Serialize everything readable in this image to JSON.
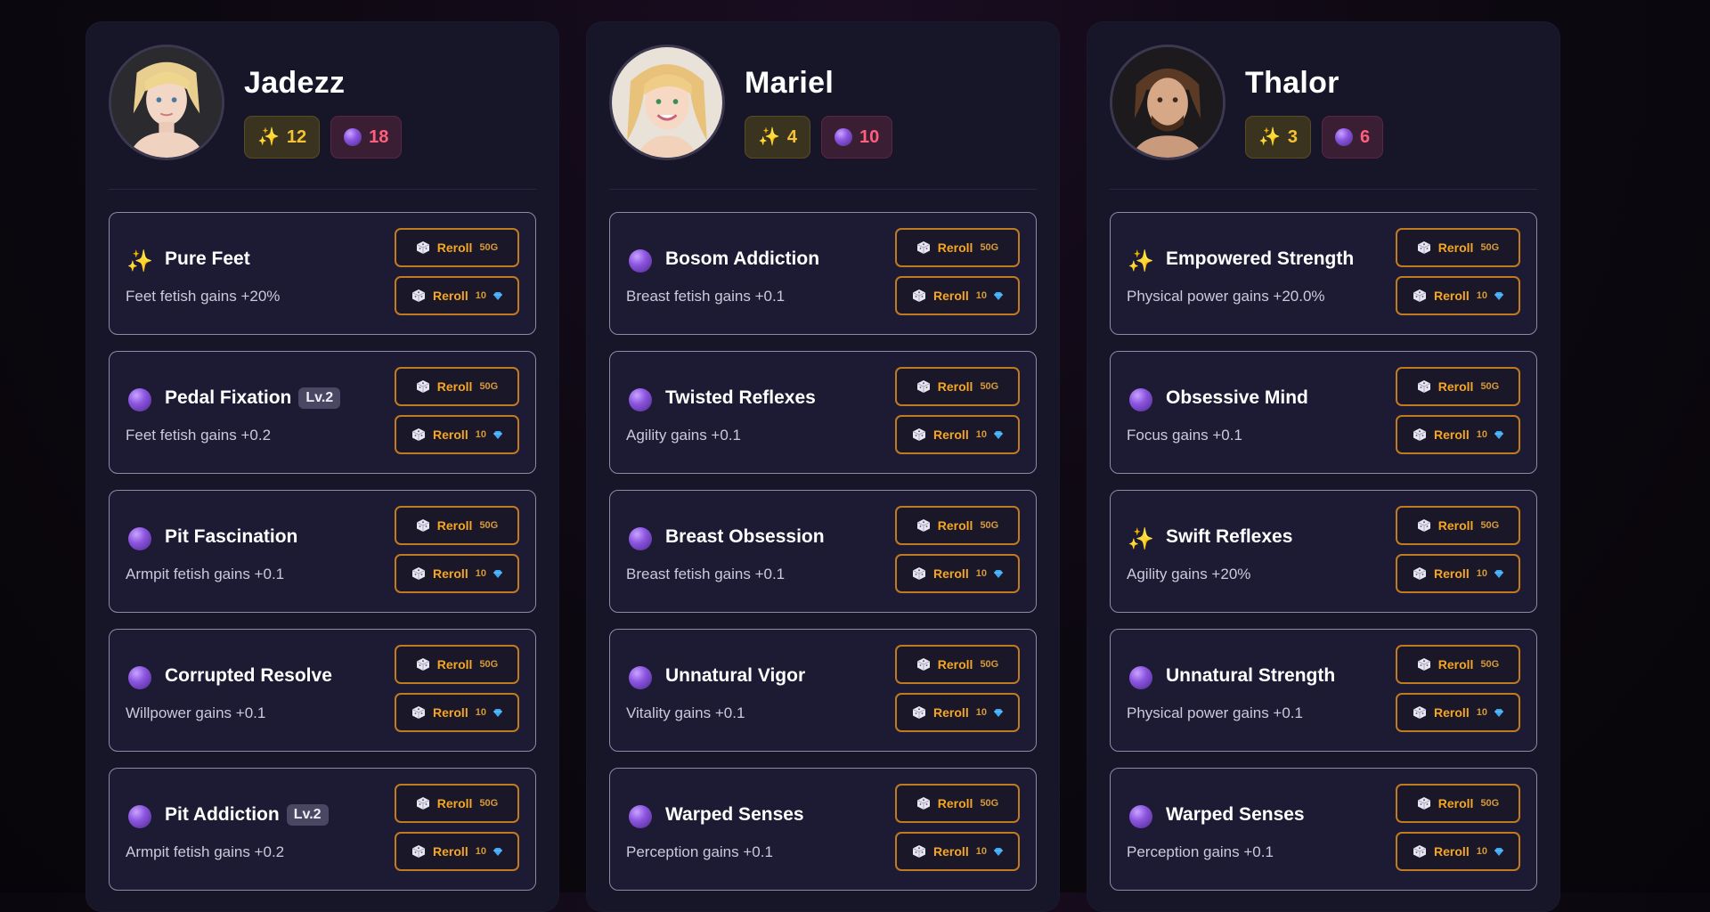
{
  "characters": [
    {
      "name": "Jadezz",
      "gold_count": "12",
      "orb_count": "18",
      "traits": [
        {
          "icon": "sparkles-icon",
          "name": "Pure Feet",
          "level": "",
          "desc": "Feet fetish gains +20%"
        },
        {
          "icon": "orb-icon",
          "name": "Pedal Fixation",
          "level": "Lv.2",
          "desc": "Feet fetish gains +0.2"
        },
        {
          "icon": "orb-icon",
          "name": "Pit Fascination",
          "level": "",
          "desc": "Armpit fetish gains +0.1"
        },
        {
          "icon": "orb-icon",
          "name": "Corrupted Resolve",
          "level": "",
          "desc": "Willpower gains +0.1"
        },
        {
          "icon": "orb-icon",
          "name": "Pit Addiction",
          "level": "Lv.2",
          "desc": "Armpit fetish gains +0.2"
        }
      ]
    },
    {
      "name": "Mariel",
      "gold_count": "4",
      "orb_count": "10",
      "traits": [
        {
          "icon": "orb-icon",
          "name": "Bosom Addiction",
          "level": "",
          "desc": "Breast fetish gains +0.1"
        },
        {
          "icon": "orb-icon",
          "name": "Twisted Reflexes",
          "level": "",
          "desc": "Agility gains +0.1"
        },
        {
          "icon": "orb-icon",
          "name": "Breast Obsession",
          "level": "",
          "desc": "Breast fetish gains +0.1"
        },
        {
          "icon": "orb-icon",
          "name": "Unnatural Vigor",
          "level": "",
          "desc": "Vitality gains +0.1"
        },
        {
          "icon": "orb-icon",
          "name": "Warped Senses",
          "level": "",
          "desc": "Perception gains +0.1"
        }
      ]
    },
    {
      "name": "Thalor",
      "gold_count": "3",
      "orb_count": "6",
      "traits": [
        {
          "icon": "sparkles-icon",
          "name": "Empowered Strength",
          "level": "",
          "desc": "Physical power gains +20.0%"
        },
        {
          "icon": "orb-icon",
          "name": "Obsessive Mind",
          "level": "",
          "desc": "Focus gains +0.1"
        },
        {
          "icon": "sparkles-icon",
          "name": "Swift Reflexes",
          "level": "",
          "desc": "Agility gains +20%"
        },
        {
          "icon": "orb-icon",
          "name": "Unnatural Strength",
          "level": "",
          "desc": "Physical power gains +0.1"
        },
        {
          "icon": "orb-icon",
          "name": "Warped Senses",
          "level": "",
          "desc": "Perception gains +0.1"
        }
      ]
    }
  ],
  "reroll": {
    "label": "Reroll",
    "gold_cost": "50G",
    "gem_cost": "10"
  },
  "colors": {
    "accent_gold": "#f5a623",
    "reroll_border": "#c07a22",
    "gold_counter": "#f5c333",
    "orb_counter": "#ff5f7e",
    "panel_bg": "#171528",
    "card_bg": "#1d1a33"
  }
}
